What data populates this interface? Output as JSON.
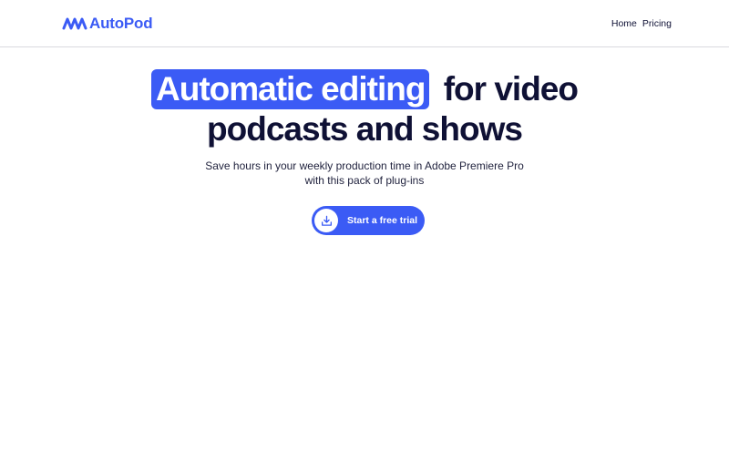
{
  "brand": {
    "name": "AutoPod",
    "color": "#3b5bf5",
    "logo_icon": "waveform-logo-icon"
  },
  "nav": {
    "home": "Home",
    "pricing": "Pricing"
  },
  "hero": {
    "title_highlight": "Automatic editing",
    "title_rest_line1": "for video",
    "title_line2": "podcasts and shows",
    "subtitle_line1": "Save hours in your weekly production time in Adobe Premiere Pro",
    "subtitle_line2": "with this pack of plug-ins"
  },
  "cta": {
    "label": "Start a free trial",
    "icon": "download-icon"
  },
  "colors": {
    "accent": "#3b5bf5",
    "text_dark": "#0f1135"
  }
}
